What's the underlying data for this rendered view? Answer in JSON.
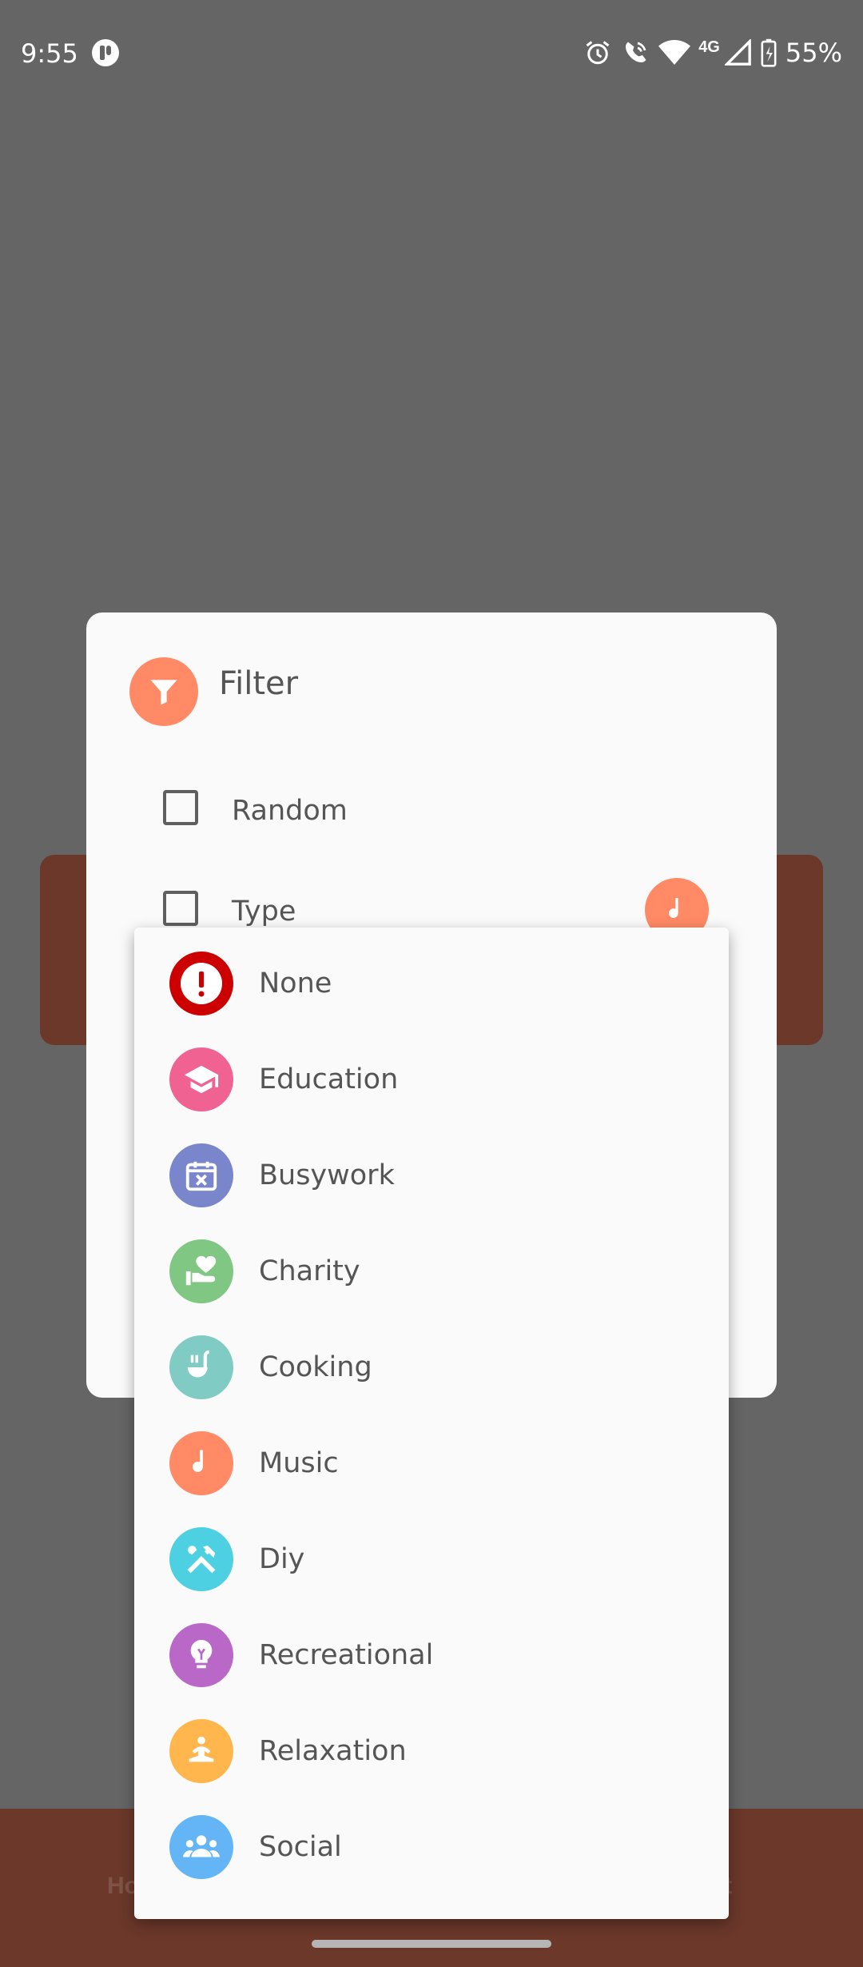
{
  "status_bar": {
    "time": "9:55",
    "network": "4G",
    "battery": "55%"
  },
  "background": {
    "nav_home_fragment": "Ho",
    "nav_about_fragment": "ut"
  },
  "dialog": {
    "title": "Filter",
    "title_icon": "filter-icon",
    "options": [
      {
        "label": "Random",
        "checked": false
      },
      {
        "label": "Type",
        "checked": false,
        "selected_type_icon": "music-icon"
      }
    ]
  },
  "dropdown": {
    "items": [
      {
        "label": "None",
        "icon": "alert-icon",
        "color": "#cc0000"
      },
      {
        "label": "Education",
        "icon": "graduation-cap-icon",
        "color": "#f06292"
      },
      {
        "label": "Busywork",
        "icon": "calendar-x-icon",
        "color": "#7986cb"
      },
      {
        "label": "Charity",
        "icon": "hand-heart-icon",
        "color": "#81c784"
      },
      {
        "label": "Cooking",
        "icon": "ladle-icon",
        "color": "#80cbc4"
      },
      {
        "label": "Music",
        "icon": "music-note-icon",
        "color": "#ff8a65"
      },
      {
        "label": "Diy",
        "icon": "tools-icon",
        "color": "#4dd0e1"
      },
      {
        "label": "Recreational",
        "icon": "lightbulb-icon",
        "color": "#ba68c8"
      },
      {
        "label": "Relaxation",
        "icon": "meditation-icon",
        "color": "#ffb74d"
      },
      {
        "label": "Social",
        "icon": "group-icon",
        "color": "#64b5f6"
      }
    ]
  }
}
